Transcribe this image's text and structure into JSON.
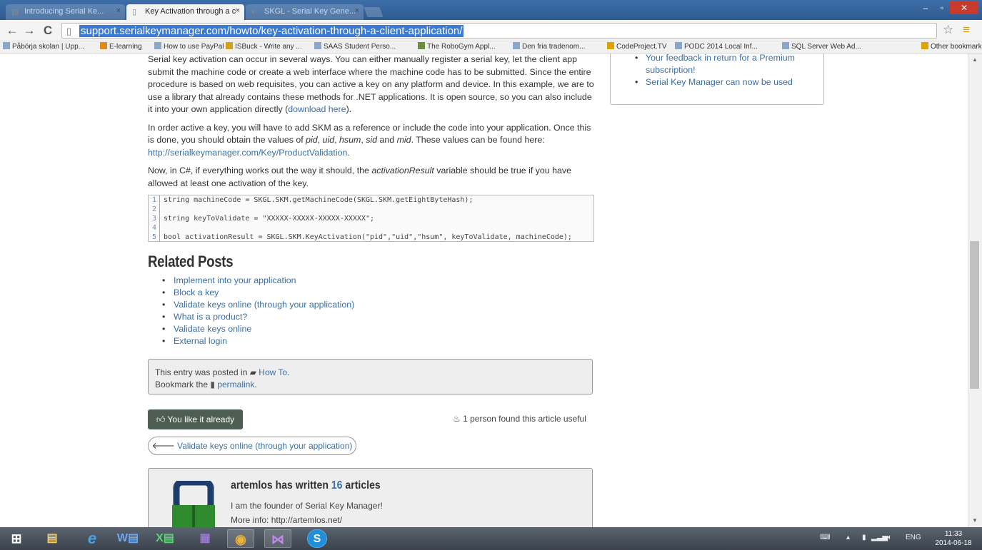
{
  "browser": {
    "tabs": [
      {
        "title": "Introducing Serial Ke...",
        "active": false
      },
      {
        "title": "Key Activation through a c",
        "active": true
      },
      {
        "title": "SKGL - Serial Key Gene...",
        "active": false
      }
    ],
    "url": "support.serialkeymanager.com/howto/key-activation-through-a-client-application/",
    "bookmarks": [
      "Påbörja skolan | Upp...",
      "E-learning",
      "How to use PayPal ...",
      "ISBuck - Write any ...",
      "SAAS Student Perso...",
      "The RoboGym Appl...",
      "Den fria tradenom...",
      "CodeProject.TV",
      "PODC 2014 Local Inf...",
      "SQL Server Web Ad..."
    ],
    "other_bookmarks": "Other bookmarks"
  },
  "article": {
    "p1": {
      "text": "Serial key activation can occur in several ways. You can either manually register a serial key, let the client app submit the machine code or create a web interface where the machine code has to be submitted. Since the entire procedure is based on web requisites, you can active a key on any platform and device. In this example, we are to use a library that already contains these methods for .NET applications. It is open source, so you can also include it into your own application directly (",
      "link": "download here",
      "after": ")."
    },
    "p2": {
      "t1": "In order active a key, you will have to add SKM as a reference or include the code into your application. Once this is done, you should obtain the values of ",
      "pid": "pid",
      "c1": ", ",
      "uid": "uid",
      "c2": ", ",
      "hsum": "hsum",
      "c3": ", ",
      "sid": "sid",
      "and": " and ",
      "mid": "mid",
      "t2": ". These values can be found here: ",
      "link": "http://serialkeymanager.com/Key/ProductValidation",
      "end": "."
    },
    "p3": {
      "t1": "Now, in C#, if everything works out the way it should, the ",
      "var": "activationResult",
      "t2": " variable should be true if you have allowed at least one activation of the key."
    }
  },
  "code": [
    {
      "n": "1",
      "text": "string machineCode = SKGL.SKM.getMachineCode(SKGL.SKM.getEightByteHash);"
    },
    {
      "n": "2",
      "text": ""
    },
    {
      "n": "3",
      "text": "string keyToValidate = \"XXXXX-XXXXX-XXXXX-XXXXX\";"
    },
    {
      "n": "4",
      "text": ""
    },
    {
      "n": "5",
      "text": "bool activationResult = SKGL.SKM.KeyActivation(\"pid\",\"uid\",\"hsum\", keyToValidate, machineCode);"
    }
  ],
  "related": {
    "title": "Related Posts",
    "items": [
      "Implement into your application",
      "Block a key",
      "Validate keys online (through your application)",
      "What is a product?",
      "Validate keys online",
      "External login"
    ]
  },
  "meta": {
    "posted_prefix": "This entry was posted in ",
    "category": "How To",
    "posted_suffix": ".",
    "bookmark_prefix": "Bookmark the ",
    "permalink": "permalink",
    "bookmark_suffix": "."
  },
  "like": {
    "button": "You like it already",
    "useful": "1 person found this article useful"
  },
  "nav": {
    "prev": "Validate keys online (through your application)"
  },
  "author": {
    "name_prefix": "artemlos has written ",
    "count": "16",
    "name_suffix": " articles",
    "bio1": "I am the founder of Serial Key Manager!",
    "bio2": "More info: http://artemlos.net/"
  },
  "sidebar": {
    "items": [
      "Your feedback in return for a Premium subscription!",
      "Serial Key Manager can now be used"
    ]
  },
  "taskbar": {
    "word": "W",
    "excel": "X",
    "skype": "S",
    "lang": "ENG",
    "time": "11:33",
    "date": "2014-06-18"
  },
  "colors": {
    "link": "#3a6fa6",
    "like_button": "#4e5e53",
    "chrome_frame": "#2e5a91",
    "close_button": "#c73b2d"
  }
}
